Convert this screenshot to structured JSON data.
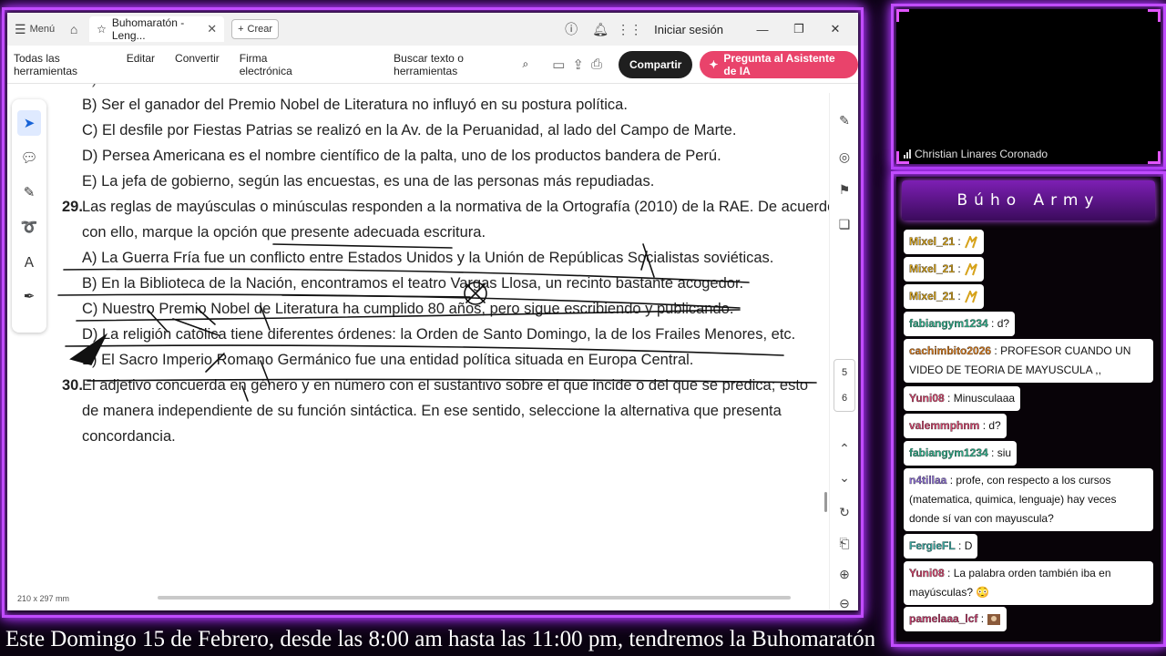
{
  "pdf": {
    "menu_label": "Menú",
    "tab_title": "Buhomaratón - Leng...",
    "new_label": "Crear",
    "sign_in": "Iniciar sesión",
    "toolbar": {
      "all_tools": "Todas las herramientas",
      "edit": "Editar",
      "convert": "Convertir",
      "esign": "Firma electrónica",
      "search": "Buscar texto o herramientas",
      "share": "Compartir",
      "ai": "Pregunta al Asistente de IA"
    },
    "page_size": "210 x 297 mm",
    "pages": [
      "5",
      "6"
    ],
    "content": {
      "b": "B) Ser el ganador del Premio Nobel de Literatura no influyó en su postura política.",
      "c": "C) El desfile por Fiestas Patrias se realizó en la Av. de la Peruanidad, al lado del Campo de Marte.",
      "d": "D) Persea Americana es el nombre científico de la palta, uno de los productos bandera de Perú.",
      "e": "E) La jefa de gobierno, según las encuestas, es una de las personas más repudiadas.",
      "q29_num": "29.",
      "q29_l1": "Las reglas de mayúsculas o minúsculas responden a la normativa de la Ortografía (2010) de la RAE. De acuerdo",
      "q29_l2": "con ello, marque la opción que presente adecuada escritura.",
      "q29_a": "A) La Guerra Fría fue un conflicto entre Estados Unidos y la Unión de Repúblicas Socialistas soviéticas.",
      "q29_b": "B) En la Biblioteca de la Nación, encontramos el teatro Vargas Llosa, un recinto bastante acogedor.",
      "q29_c": "C) Nuestro Premio Nobel de Literatura ha cumplido 80 años, pero sigue escribiendo y publicando.",
      "q29_d": "D) La religión católica tiene diferentes órdenes: la Orden de Santo Domingo, la de los Frailes Menores, etc.",
      "q29_e": "E) El Sacro Imperio Romano Germánico fue una entidad política situada en Europa Central.",
      "q30_num": "30.",
      "q30_l1": "El adjetivo concuerda en género y en número con el sustantivo sobre el que incide o del que se predica; esto",
      "q30_l2": "de manera independiente de su función sintáctica. En ese sentido, seleccione la alternativa que presenta",
      "q30_l3": "concordancia."
    }
  },
  "stream": {
    "cam_name": "Christian Linares Coronado",
    "chat_title": "Búho Army",
    "messages": [
      {
        "user": "Mixel_21",
        "color": "#d6a21a",
        "text": ""
      },
      {
        "user": "Mixel_21",
        "color": "#d6a21a",
        "text": ""
      },
      {
        "user": "Mixel_21",
        "color": "#d6a21a",
        "text": ""
      },
      {
        "user": "fabiangym1234",
        "color": "#2fae8a",
        "text": "d?"
      },
      {
        "user": "cachimbito2026",
        "color": "#d57a1e",
        "text": "PROFESOR CUANDO UN VIDEO DE TEORIA DE MAYUSCULA ,,"
      },
      {
        "user": "Yuni08",
        "color": "#d4476e",
        "text": "Minusculaaa"
      },
      {
        "user": "valemmphnm",
        "color": "#d4476e",
        "text": "d?"
      },
      {
        "user": "fabiangym1234",
        "color": "#2fae8a",
        "text": "siu"
      },
      {
        "user": "n4tillaa",
        "color": "#8d6fd6",
        "text": "profe, con respecto a los cursos (matematica, quimica, lenguaje) hay veces donde sí van con mayuscula?"
      },
      {
        "user": "FergieFL",
        "color": "#3aa7a0",
        "text": "D"
      },
      {
        "user": "Yuni08",
        "color": "#d4476e",
        "text": "La palabra orden también iba en mayúsculas? 😳"
      },
      {
        "user": "pamelaaa_lcf",
        "color": "#c23b6a",
        "text": ""
      }
    ],
    "ticker": "Este Domingo 15 de Febrero, desde las 8:00 am hasta las 11:00 pm, tendremos la Buhomaratón"
  }
}
